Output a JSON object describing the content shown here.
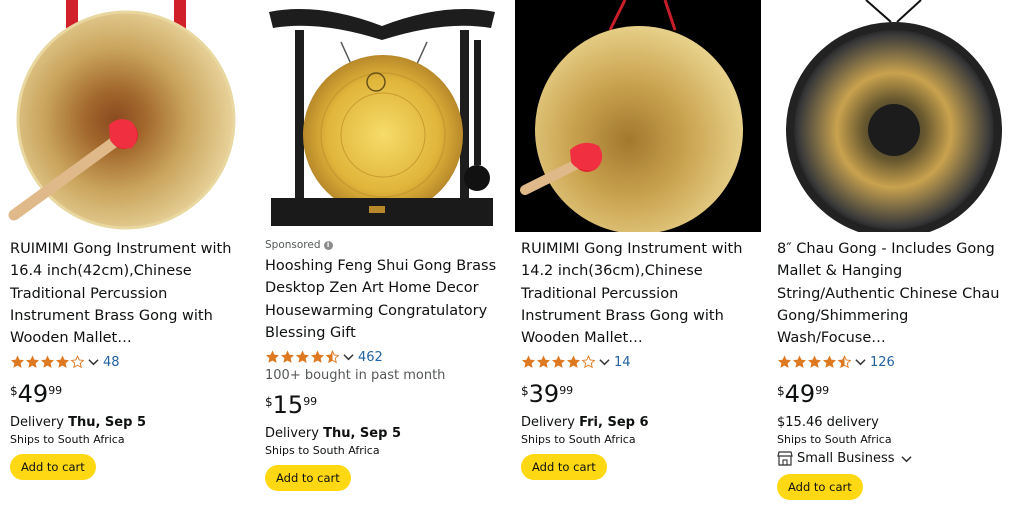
{
  "products": [
    {
      "sponsored": "",
      "title": "RUIMIMI Gong Instrument with 16.4 inch(42cm),Chinese Traditional Percussion Instrument Brass Gong with Wooden Mallet…",
      "rating": 4.0,
      "review_count": "48",
      "bought": "",
      "price": {
        "symbol": "$",
        "whole": "49",
        "fraction": "99"
      },
      "delivery_prefix": "Delivery ",
      "delivery_date": "Thu, Sep 5",
      "ships": "Ships to South Africa",
      "small_business": "",
      "add_to_cart": "Add to cart",
      "image": "gong-with-mallet-icon"
    },
    {
      "sponsored": "Sponsored",
      "title": "Hooshing Feng Shui Gong Brass Desktop Zen Art Home Decor Housewarming Congratulatory Blessing Gift",
      "rating": 4.5,
      "review_count": "462",
      "bought": "100+ bought in past month",
      "price": {
        "symbol": "$",
        "whole": "15",
        "fraction": "99"
      },
      "delivery_prefix": "Delivery ",
      "delivery_date": "Thu, Sep 5",
      "ships": "Ships to South Africa",
      "small_business": "",
      "add_to_cart": "Add to cart",
      "image": "desktop-gong-stand-icon"
    },
    {
      "sponsored": "",
      "title": "RUIMIMI Gong Instrument with 14.2 inch(36cm),Chinese Traditional Percussion Instrument Brass Gong with Wooden Mallet…",
      "rating": 4.0,
      "review_count": "14",
      "bought": "",
      "price": {
        "symbol": "$",
        "whole": "39",
        "fraction": "99"
      },
      "delivery_prefix": "Delivery ",
      "delivery_date": "Fri, Sep 6",
      "ships": "Ships to South Africa",
      "small_business": "",
      "add_to_cart": "Add to cart",
      "image": "gong-with-mallet-icon"
    },
    {
      "sponsored": "",
      "title": "8″ Chau Gong - Includes Gong Mallet & Hanging String/Authentic Chinese Chau Gong/Shimmering Wash/Focuse…",
      "rating": 4.5,
      "review_count": "126",
      "bought": "",
      "price": {
        "symbol": "$",
        "whole": "49",
        "fraction": "99"
      },
      "delivery_prefix": "",
      "delivery_date": "$15.46 delivery",
      "ships": "Ships to South Africa",
      "small_business": "Small Business",
      "add_to_cart": "Add to cart",
      "image": "chau-gong-icon"
    }
  ],
  "colors": {
    "star": "#de7921",
    "link": "#2162a1",
    "button": "#ffd814",
    "gold": "#c9a74e"
  }
}
